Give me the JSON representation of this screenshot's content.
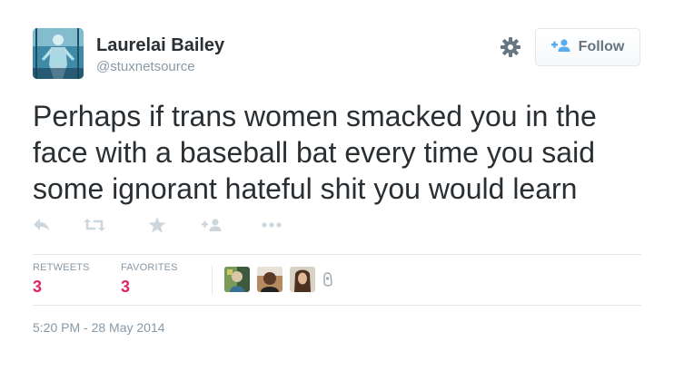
{
  "author": {
    "name": "Laurelai Bailey",
    "handle": "@stuxnetsource"
  },
  "follow_button": {
    "label": "Follow"
  },
  "tweet": {
    "text": "Perhaps if trans women smacked you in the face with a baseball bat every time you said some ignorant hateful shit you would learn"
  },
  "actions": [
    {
      "icon": "reply-icon"
    },
    {
      "icon": "retweet-icon"
    },
    {
      "icon": "favorite-star-icon"
    },
    {
      "icon": "follow-icon"
    },
    {
      "icon": "more-dots-icon"
    }
  ],
  "stats": {
    "retweets_label": "RETWEETS",
    "retweets_count": "3",
    "favorites_label": "FAVORITES",
    "favorites_count": "3"
  },
  "timestamp": "5:20 PM - 28 May 2014",
  "colors": {
    "count_accent": "#e0245e",
    "muted_text": "#8899a6",
    "follow_icon": "#55acee"
  }
}
